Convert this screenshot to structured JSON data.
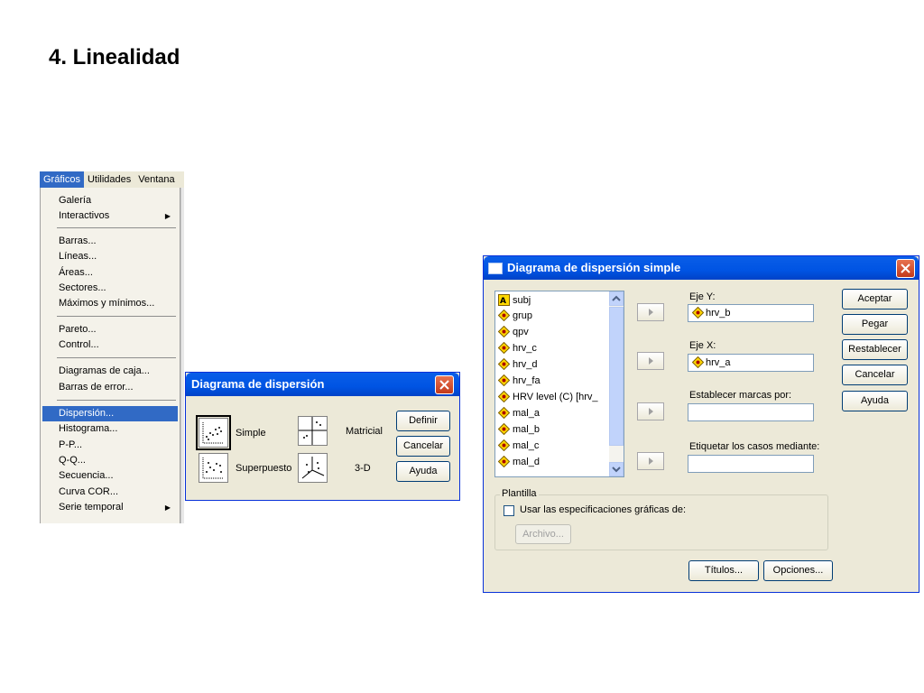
{
  "slide": {
    "title": "4. Linealidad"
  },
  "menu": {
    "bar": [
      "Gráficos",
      "Utilidades",
      "Ventana"
    ],
    "items": [
      {
        "label": "Galería",
        "submenu": false
      },
      {
        "label": "Interactivos",
        "submenu": true
      },
      {
        "label": "Barras...",
        "submenu": false
      },
      {
        "label": "Líneas...",
        "submenu": false
      },
      {
        "label": "Áreas...",
        "submenu": false
      },
      {
        "label": "Sectores...",
        "submenu": false
      },
      {
        "label": "Máximos y mínimos...",
        "submenu": false
      },
      {
        "label": "Pareto...",
        "submenu": false
      },
      {
        "label": "Control...",
        "submenu": false
      },
      {
        "label": "Diagramas de caja...",
        "submenu": false
      },
      {
        "label": "Barras de error...",
        "submenu": false
      },
      {
        "label": "Dispersión...",
        "submenu": false,
        "selected": true
      },
      {
        "label": "Histograma...",
        "submenu": false
      },
      {
        "label": "P-P...",
        "submenu": false
      },
      {
        "label": "Q-Q...",
        "submenu": false
      },
      {
        "label": "Secuencia...",
        "submenu": false
      },
      {
        "label": "Curva COR...",
        "submenu": false
      },
      {
        "label": "Serie temporal",
        "submenu": true
      }
    ]
  },
  "gallery_dialog": {
    "title": "Diagrama de dispersión",
    "options": {
      "simple": "Simple",
      "superpuesto": "Superpuesto",
      "matricial": "Matricial",
      "3d": "3-D"
    },
    "buttons": {
      "definir": "Definir",
      "cancelar": "Cancelar",
      "ayuda": "Ayuda"
    }
  },
  "simple_dialog": {
    "title": "Diagrama de dispersión simple",
    "variables": [
      {
        "name": "subj",
        "type": "string"
      },
      {
        "name": "grup",
        "type": "numeric"
      },
      {
        "name": "qpv",
        "type": "numeric"
      },
      {
        "name": "hrv_c",
        "type": "numeric"
      },
      {
        "name": "hrv_d",
        "type": "numeric"
      },
      {
        "name": "hrv_fa",
        "type": "numeric"
      },
      {
        "name": "HRV level (C) [hrv_",
        "type": "numeric"
      },
      {
        "name": "mal_a",
        "type": "numeric"
      },
      {
        "name": "mal_b",
        "type": "numeric"
      },
      {
        "name": "mal_c",
        "type": "numeric"
      },
      {
        "name": "mal_d",
        "type": "numeric"
      }
    ],
    "fields": {
      "eje_y_label": "Eje Y:",
      "eje_y_value": "hrv_b",
      "eje_x_label": "Eje X:",
      "eje_x_value": "hrv_a",
      "marcas_label": "Establecer marcas por:",
      "marcas_value": "",
      "etiquetar_label": "Etiquetar los casos mediante:",
      "etiquetar_value": ""
    },
    "template": {
      "group_label": "Plantilla",
      "checkbox_label": "Usar las especificaciones gráficas de:",
      "checked": false,
      "archivo_button": "Archivo..."
    },
    "buttons": {
      "aceptar": "Aceptar",
      "pegar": "Pegar",
      "restablecer": "Restablecer",
      "cancelar": "Cancelar",
      "ayuda": "Ayuda",
      "titulos": "Títulos...",
      "opciones": "Opciones..."
    }
  }
}
